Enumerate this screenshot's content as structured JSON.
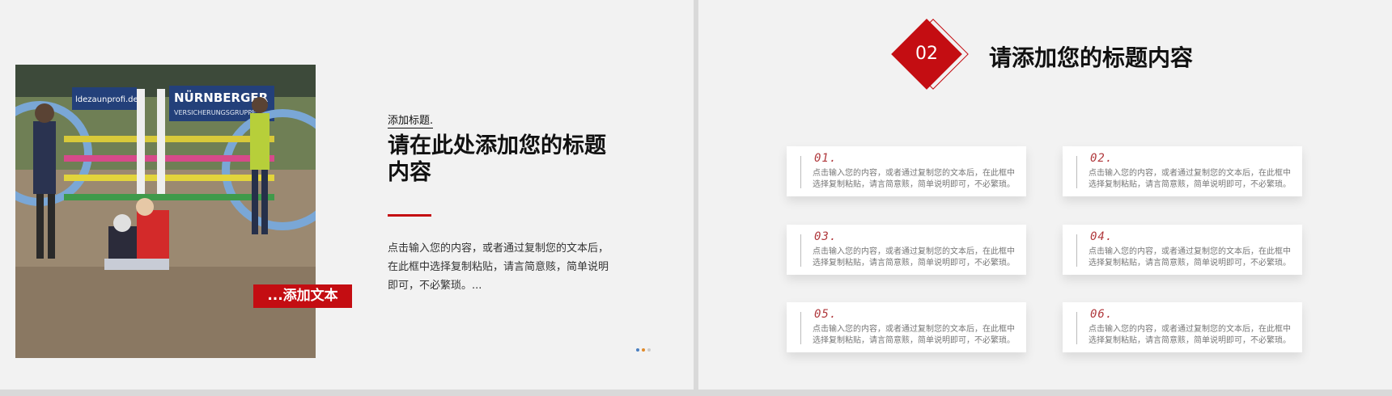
{
  "left_slide": {
    "image_tag": "...添加文本",
    "small_title": "添加标题.",
    "big_title": "请在此处添加您的标题内容",
    "body": "点击输入您的内容，或者通过复制您的文本后，在此框中选择复制粘贴，请言简意赅，简单说明即可，不必繁琐。...",
    "photo_signage": [
      "NÜRNBERGER",
      "VERSICHERUNGSGRUPPE",
      "ldezaunprofi.de"
    ],
    "pagination_dot_colors": [
      "#4a7fc1",
      "#e08a2a",
      "#cccccc"
    ]
  },
  "right_slide": {
    "section_number": "02",
    "section_title": "请添加您的标题内容",
    "cards": [
      {
        "num": "01.",
        "text": "点击输入您的内容，或者通过复制您的文本后，在此框中选择复制粘贴，请言简意赅，简单说明即可，不必繁琐。"
      },
      {
        "num": "02.",
        "text": "点击输入您的内容，或者通过复制您的文本后，在此框中选择复制粘贴，请言简意赅，简单说明即可，不必繁琐。"
      },
      {
        "num": "03.",
        "text": "点击输入您的内容，或者通过复制您的文本后，在此框中选择复制粘贴，请言简意赅，简单说明即可，不必繁琐。"
      },
      {
        "num": "04.",
        "text": "点击输入您的内容，或者通过复制您的文本后，在此框中选择复制粘贴，请言简意赅，简单说明即可，不必繁琐。"
      },
      {
        "num": "05.",
        "text": "点击输入您的内容，或者通过复制您的文本后，在此框中选择复制粘贴，请言简意赅，简单说明即可，不必繁琐。"
      },
      {
        "num": "06.",
        "text": "点击输入您的内容，或者通过复制您的文本后，在此框中选择复制粘贴，请言简意赅，简单说明即可，不必繁琐。"
      }
    ]
  },
  "colors": {
    "accent": "#c40d12",
    "background": "#f2f2f2"
  }
}
